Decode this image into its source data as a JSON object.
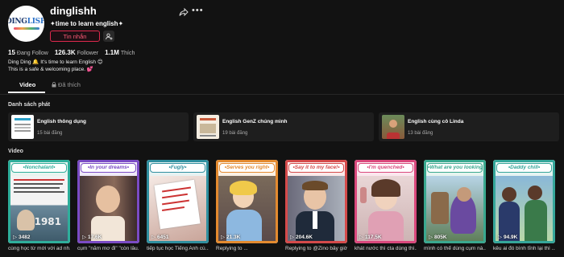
{
  "profile": {
    "avatar_line1": "DING",
    "avatar_line2": "LISH",
    "username": "dinglishh",
    "tagline": "✦time to learn english✦",
    "message_label": "Tin nhắn",
    "stats": {
      "following_value": "15",
      "following_label": "Đang Follow",
      "followers_value": "126.3K",
      "followers_label": "Follower",
      "likes_value": "1.1M",
      "likes_label": "Thích"
    },
    "bio_line1": "Ding Ding 🔔 It's time to learn English 😊",
    "bio_line2": "This is a safe & welcoming place. 💕"
  },
  "tabs": {
    "video_label": "Video",
    "liked_label": "Đã thích"
  },
  "playlists": {
    "section_title": "Danh sách phát",
    "items": [
      {
        "name": "English thông dụng",
        "count": "15 bài đăng"
      },
      {
        "name": "English GenZ chúng mình",
        "count": "19 bài đăng"
      },
      {
        "name": "English cùng cô Linda",
        "count": "13 bài đăng"
      }
    ]
  },
  "videos": {
    "section_title": "Video",
    "items": [
      {
        "title": "•Nonchalant•",
        "views": "3482",
        "caption": "cùng học từ mới với ad nh...",
        "color": "#2fae9b"
      },
      {
        "title": "•In your dreams•",
        "views": "17.6K",
        "caption": "cụm \"nằm mơ đi\" \"còn lâu...",
        "color": "#7a4bc4"
      },
      {
        "title": "•Fugly•",
        "views": "6451",
        "caption": "tiếp tục học Tiếng Anh cù...",
        "color": "#2f8f9f"
      },
      {
        "title": "•Serves you right•",
        "views": "21.3K",
        "caption": "Replying to ...",
        "color": "#e38a2f"
      },
      {
        "title": "•Say it to my face!•",
        "views": "204.6K",
        "caption": "Replying to @Zino bây giờ...",
        "color": "#d44a4a"
      },
      {
        "title": "•I'm quenched•",
        "views": "117.5K",
        "caption": "khát nước thì cta dùng thì...",
        "color": "#d9487c"
      },
      {
        "title": "•What are you looking at?•",
        "views": "805K",
        "caption": "mình có thể dùng cụm nà...",
        "color": "#3aa88f"
      },
      {
        "title": "•Daddy chill•",
        "views": "94.9K",
        "caption": "kêu ai đó bình tĩnh lại thì ...",
        "color": "#35a69a"
      }
    ]
  }
}
